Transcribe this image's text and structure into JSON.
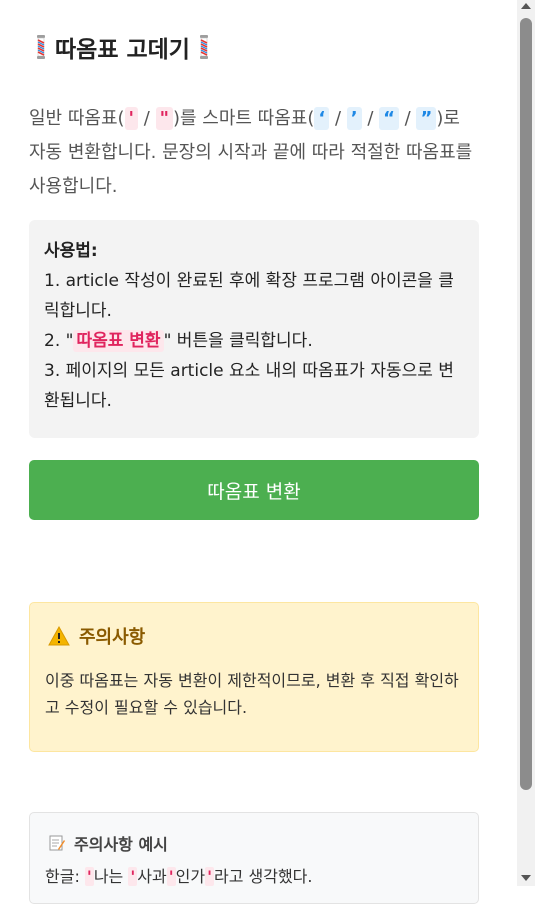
{
  "header": {
    "title": "따옴표 고데기",
    "icon_left": "barber-pole-icon",
    "icon_right": "barber-pole-icon"
  },
  "intro": {
    "p1": "일반 따옴표(",
    "q1": "'",
    "sep1": " / ",
    "q2": "\"",
    "p2": ")를 스마트 따옴표(",
    "q3": "‘",
    "sep2": " / ",
    "q4": "’",
    "sep3": " / ",
    "q5": "“",
    "sep4": " / ",
    "q6": "”",
    "p3": ")로 자동 변환합니다. 문장의 시작과 끝에 따라 적절한 따옴표를 사용합니다."
  },
  "usage": {
    "heading": "사용법:",
    "step1": "1. article 작성이 완료된 후에 확장 프로그램 아이콘을 클릭합니다.",
    "step2_prefix": "2. \"",
    "step2_highlight": "따옴표 변환",
    "step2_suffix": "\" 버튼을 클릭합니다.",
    "step3": "3. 페이지의 모든 article 요소 내의 따옴표가 자동으로 변환됩니다."
  },
  "convert_button": {
    "label": "따옴표 변환"
  },
  "warning": {
    "icon": "warning-icon",
    "title": "주의사항",
    "text": "이중 따옴표는 자동 변환이 제한적이므로, 변환 후 직접 확인하고 수정이 필요할 수 있습니다."
  },
  "example": {
    "icon": "memo-icon",
    "title": "주의사항 예시",
    "prefix": "한글: ",
    "q1": "'",
    "w1": "나는 ",
    "q2": "'",
    "w2": "사과",
    "q3": "'",
    "w3": "인가",
    "q4": "'",
    "w4": "라고 생각했다."
  },
  "colors": {
    "accent_green": "#4caf50",
    "quote_red": "#e0245e",
    "quote_blue": "#1e88e5",
    "warning_bg": "#fff3cd"
  }
}
